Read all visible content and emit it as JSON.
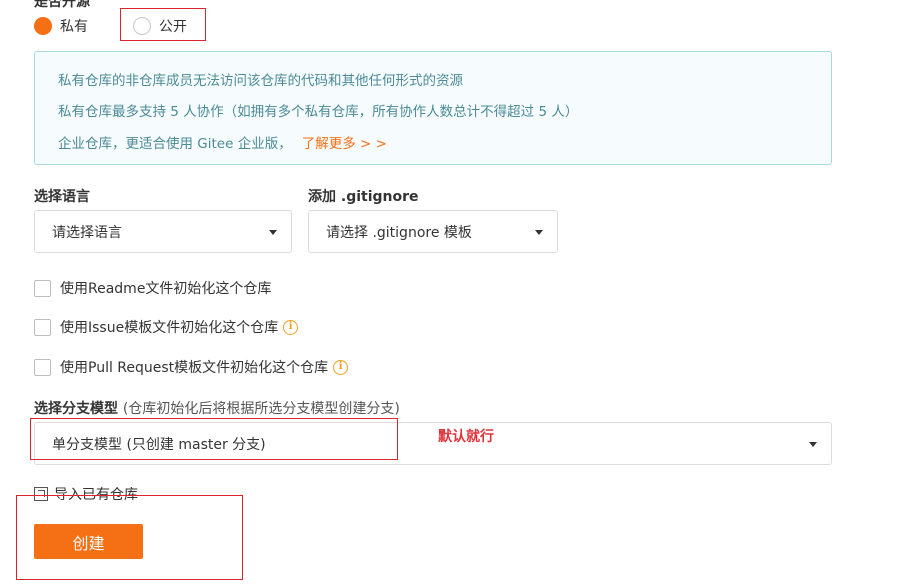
{
  "visibility": {
    "heading": "是否开源",
    "options": [
      {
        "label": "私有",
        "checked": true
      },
      {
        "label": "公开",
        "checked": false
      }
    ]
  },
  "info": {
    "line1": "私有仓库的非仓库成员无法访问该仓库的代码和其他任何形式的资源",
    "line2": "私有仓库最多支持 5 人协作（如拥有多个私有仓库，所有协作人数总计不得超过 5 人）",
    "line3": "企业仓库，更适合使用 Gitee 企业版，",
    "link": "了解更多 > >"
  },
  "language": {
    "label": "选择语言",
    "value": "请选择语言"
  },
  "gitignore": {
    "label": "添加 .gitignore",
    "value": "请选择 .gitignore 模板"
  },
  "init_options": [
    {
      "label": "使用Readme文件初始化这个仓库",
      "has_info": false
    },
    {
      "label": "使用Issue模板文件初始化这个仓库",
      "has_info": true
    },
    {
      "label": "使用Pull Request模板文件初始化这个仓库",
      "has_info": true
    }
  ],
  "branch": {
    "label": "选择分支模型",
    "hint": "(仓库初始化后将根据所选分支模型创建分支)",
    "value": "单分支模型 (只创建 master 分支)"
  },
  "annotation": "默认就行",
  "import_link": "导入已有仓库",
  "create_button": "创建",
  "colors": {
    "accent": "#f56f15",
    "info_text": "#4b8a97",
    "info_border": "#a9d9e0",
    "annotation_red": "#d9252e"
  }
}
